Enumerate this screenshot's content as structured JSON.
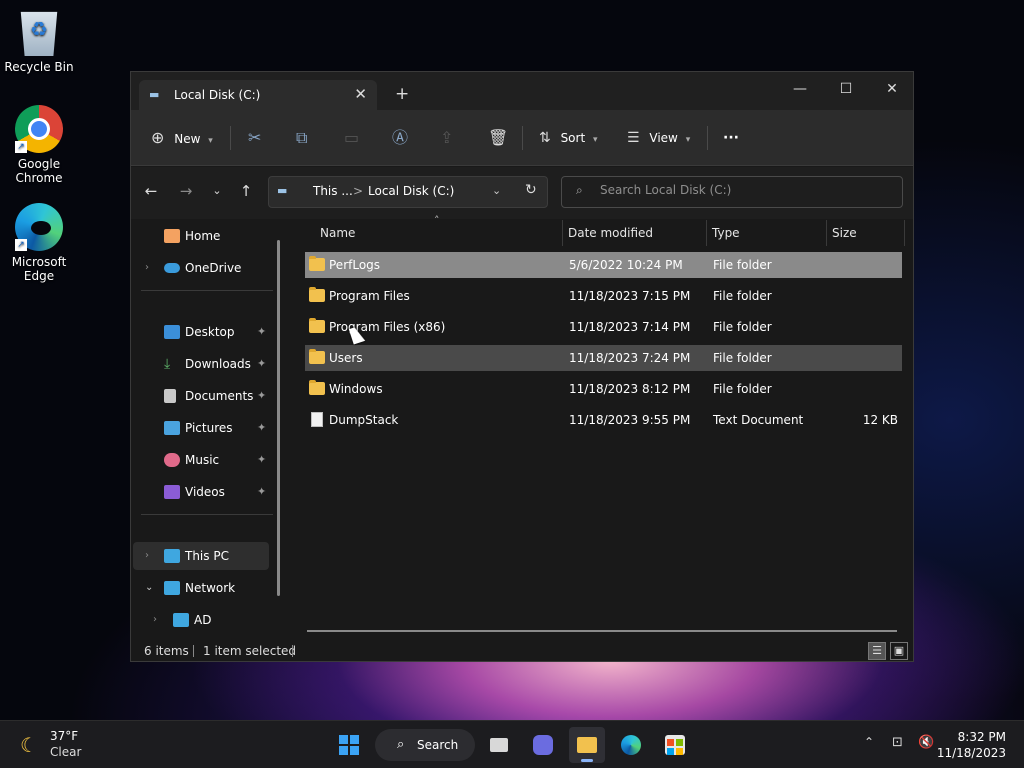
{
  "desktop": {
    "icons": [
      {
        "label": "Recycle Bin"
      },
      {
        "label": "Google Chrome"
      },
      {
        "label": "Microsoft Edge"
      }
    ]
  },
  "window": {
    "tab_title": "Local Disk (C:)",
    "controls": {
      "minimize": "—",
      "maximize": "☐",
      "close": "✕"
    },
    "toolbar": {
      "new_label": "New",
      "sort_label": "Sort",
      "view_label": "View",
      "more_label": "···"
    },
    "address": {
      "crumb_1": "This ...",
      "separator": ">",
      "crumb_2": "Local Disk (C:)"
    },
    "search": {
      "placeholder": "Search Local Disk (C:)"
    },
    "nav_pane": {
      "items": [
        {
          "label": "Home"
        },
        {
          "label": "OneDrive"
        },
        {
          "label": "Desktop"
        },
        {
          "label": "Downloads"
        },
        {
          "label": "Documents"
        },
        {
          "label": "Pictures"
        },
        {
          "label": "Music"
        },
        {
          "label": "Videos"
        },
        {
          "label": "This PC"
        },
        {
          "label": "Network"
        },
        {
          "label": "AD"
        }
      ]
    },
    "columns": {
      "name": "Name",
      "date": "Date modified",
      "type": "Type",
      "size": "Size"
    },
    "files": [
      {
        "name": "PerfLogs",
        "date": "5/6/2022 10:24 PM",
        "type": "File folder",
        "size": ""
      },
      {
        "name": "Program Files",
        "date": "11/18/2023 7:15 PM",
        "type": "File folder",
        "size": ""
      },
      {
        "name": "Program Files (x86)",
        "date": "11/18/2023 7:14 PM",
        "type": "File folder",
        "size": ""
      },
      {
        "name": "Users",
        "date": "11/18/2023 7:24 PM",
        "type": "File folder",
        "size": ""
      },
      {
        "name": "Windows",
        "date": "11/18/2023 8:12 PM",
        "type": "File folder",
        "size": ""
      },
      {
        "name": "DumpStack",
        "date": "11/18/2023 9:55 PM",
        "type": "Text Document",
        "size": "12 KB"
      }
    ],
    "status": {
      "items_count": "6 items",
      "selection": "1 item selected"
    }
  },
  "taskbar": {
    "weather": {
      "temp": "37°F",
      "condition": "Clear"
    },
    "search_label": "Search",
    "clock": {
      "time": "8:32 PM",
      "date": "11/18/2023"
    }
  }
}
